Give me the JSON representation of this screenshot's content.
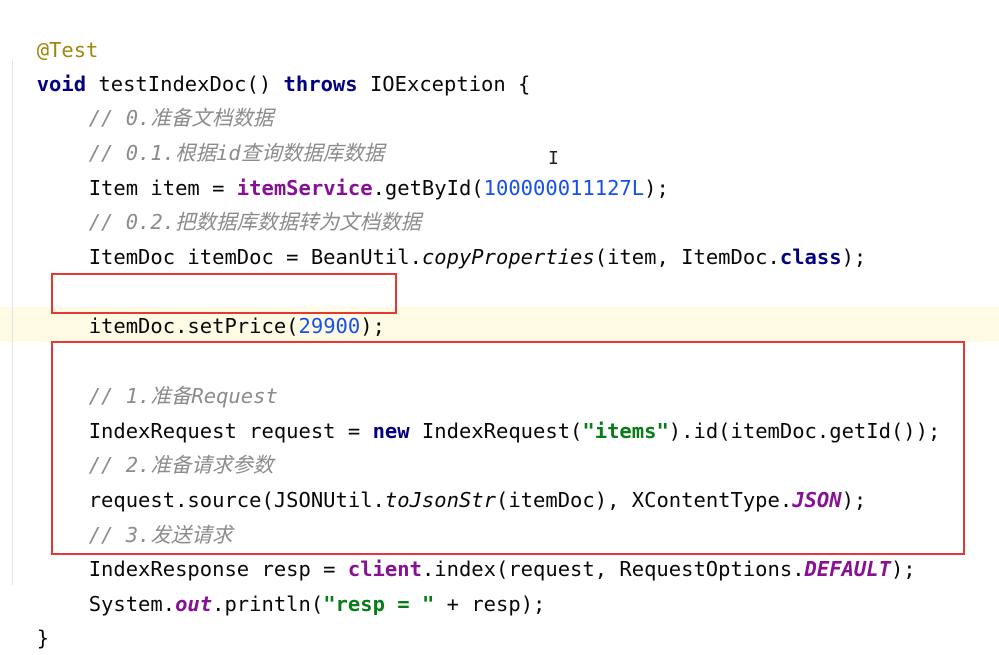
{
  "editor": {
    "annotation": "@Test",
    "method_signature": {
      "kw_void": "void",
      "name": "testIndexDoc()",
      "kw_throws": "throws",
      "exception": "IOException {"
    },
    "lines": {
      "c0": "// 0.准备文档数据",
      "c01": "// 0.1.根据id查询数据库数据",
      "l_item_pre": "Item item = ",
      "l_item_svc": "itemService",
      "l_item_call": ".getById(",
      "l_item_num": "100000011127L",
      "l_item_end": ");",
      "c02": "// 0.2.把数据库数据转为文档数据",
      "l_doc_pre": "ItemDoc itemDoc = BeanUtil.",
      "l_doc_method": "copyProperties",
      "l_doc_mid": "(item, ItemDoc.",
      "l_doc_class": "class",
      "l_doc_end": ");",
      "l_price_pre": "itemDoc.setPrice(",
      "l_price_num": "29900",
      "l_price_end": ");",
      "c1": "// 1.准备Request",
      "l_req_pre": "IndexRequest request = ",
      "l_req_new": "new",
      "l_req_mid": " IndexRequest(",
      "l_req_str": "\"items\"",
      "l_req_end": ").id(itemDoc.getId());",
      "c2": "// 2.准备请求参数",
      "l_src_pre": "request.source(JSONUtil.",
      "l_src_method": "toJsonStr",
      "l_src_mid": "(itemDoc), XContentType.",
      "l_src_const": "JSON",
      "l_src_end": ");",
      "c3": "// 3.发送请求",
      "l_resp_pre": "IndexResponse resp = ",
      "l_resp_client": "client",
      "l_resp_mid": ".index(request, RequestOptions.",
      "l_resp_const": "DEFAULT",
      "l_resp_end": ");",
      "l_print_pre": "System.",
      "l_print_out": "out",
      "l_print_mid": ".println(",
      "l_print_str": "\"resp = \"",
      "l_print_end": " + resp);",
      "close_brace": "}"
    }
  },
  "colors": {
    "highlight_box": "#e53935",
    "current_line": "#fffae3"
  }
}
